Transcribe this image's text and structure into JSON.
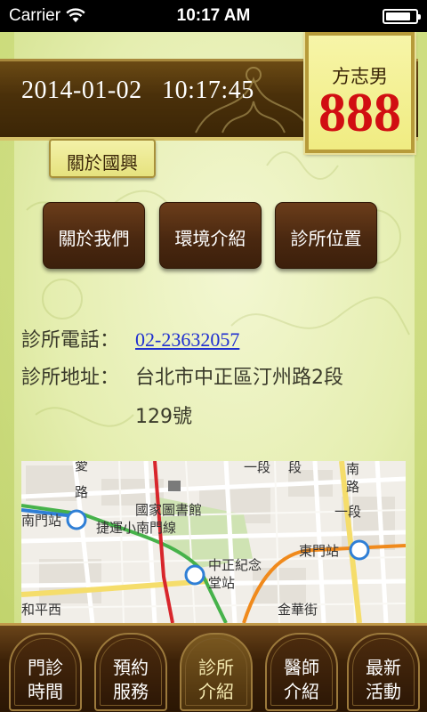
{
  "status_bar": {
    "carrier": "Carrier",
    "time": "10:17 AM",
    "battery_level": 0.85
  },
  "header": {
    "date": "2014-01-02",
    "time": "10:17:45",
    "user_name": "方志男",
    "queue_number": "888",
    "number_color": "#d10e12"
  },
  "section": {
    "title": "關於國興"
  },
  "sub_buttons": [
    {
      "label": "關於我們"
    },
    {
      "label": "環境介紹"
    },
    {
      "label": "診所位置"
    }
  ],
  "clinic": {
    "phone_label": "診所電話：",
    "phone": "02-23632057",
    "address_label": "診所地址：",
    "address_line1": "台北市中正區汀州路2段",
    "address_line2": "129號"
  },
  "map": {
    "labels": {
      "library": "國家圖書館",
      "nanmen_station": "南門站",
      "xiaonanmen_line": "捷運小南門線",
      "cks_station_1": "中正紀念",
      "cks_station_2": "堂站",
      "dongmen_station": "東門站",
      "road_top": "一段",
      "road_top2": "段",
      "road_right": "南",
      "road_right2": "路",
      "road_right3": "一段",
      "road_left": "愛",
      "road_left2": "路",
      "road_bottom_left": "和平西",
      "road_bottom_right": "金華街"
    }
  },
  "tabs": [
    {
      "label": "門診\n時間"
    },
    {
      "label": "預約\n服務"
    },
    {
      "label": "診所\n介紹"
    },
    {
      "label": "醫師\n介紹"
    },
    {
      "label": "最新\n活動"
    }
  ]
}
